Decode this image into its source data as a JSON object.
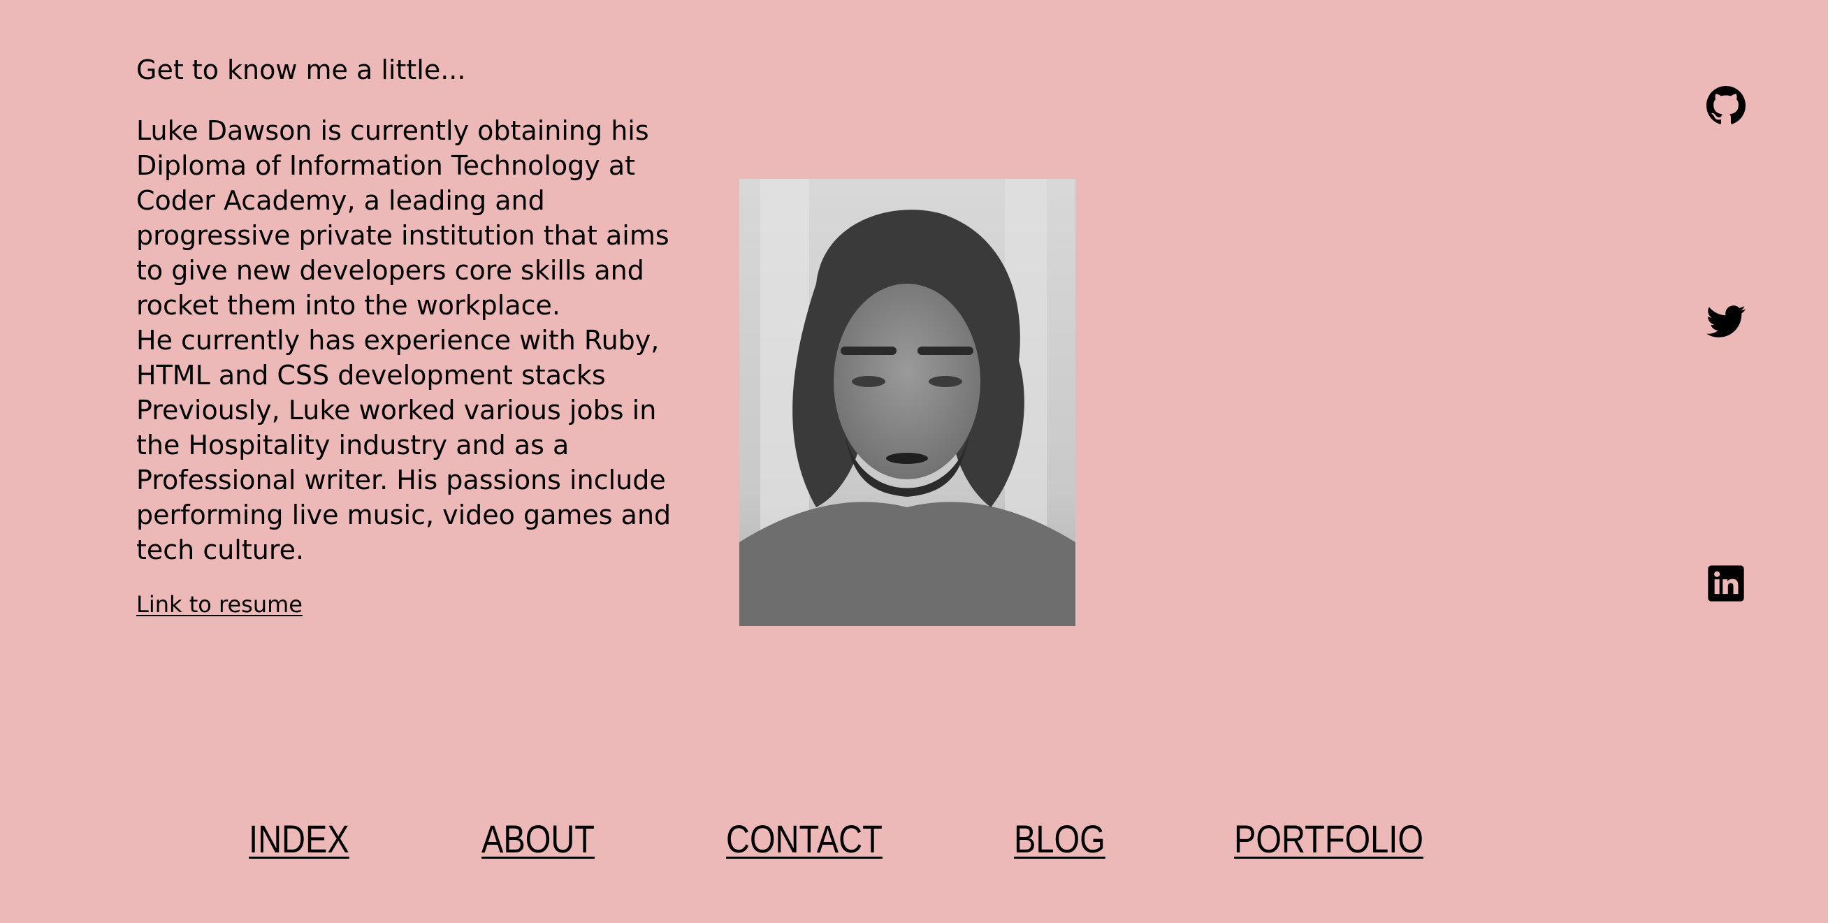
{
  "about": {
    "heading": "Get to know me a little...",
    "paragraphs": [
      "Luke Dawson is currently obtaining his Diploma of Information Technology at Coder Academy, a leading and progressive private institution that aims to give new developers core skills and rocket them into the workplace.",
      "He currently has experience with Ruby, HTML and CSS development stacks",
      "Previously, Luke worked various jobs in the Hospitality industry and as a Professional writer. His passions include performing live music, video games and tech culture."
    ],
    "resume_link": "Link to resume"
  },
  "social": {
    "github": "github-icon",
    "twitter": "twitter-icon",
    "linkedin": "linkedin-icon"
  },
  "nav": {
    "items": [
      "INDEX",
      "ABOUT",
      "CONTACT",
      "BLOG",
      "PORTFOLIO"
    ]
  },
  "colors": {
    "background": "#ecb8b8",
    "text": "#000000"
  }
}
